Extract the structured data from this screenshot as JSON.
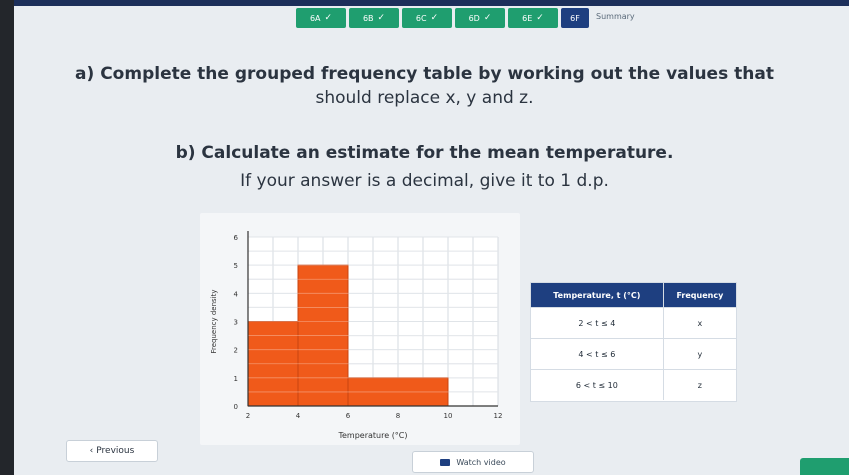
{
  "header": {
    "progress_tabs": [
      {
        "label": "6A",
        "completed": true
      },
      {
        "label": "6B",
        "completed": true
      },
      {
        "label": "6C",
        "completed": true
      },
      {
        "label": "6D",
        "completed": true
      },
      {
        "label": "6E",
        "completed": true
      },
      {
        "label": "6F",
        "completed": false
      }
    ],
    "summary_label": "Summary"
  },
  "question": {
    "part_a_line1": "a) Complete the grouped frequency table by working out the values that",
    "part_a_line2": "should replace x, y and z.",
    "part_b_line1": "b) Calculate an estimate for the mean temperature.",
    "part_b_line2": "If your answer is a decimal, give it to 1 d.p."
  },
  "chart_data": {
    "type": "bar",
    "xlabel": "Temperature (°C)",
    "ylabel": "Frequency density",
    "x_ticks": [
      2,
      4,
      6,
      8,
      10,
      12
    ],
    "y_ticks": [
      0,
      1,
      2,
      3,
      4,
      5,
      6
    ],
    "xlim": [
      2,
      12
    ],
    "ylim": [
      0,
      6
    ],
    "bars": [
      {
        "x0": 2,
        "x1": 4,
        "value": 3
      },
      {
        "x0": 4,
        "x1": 6,
        "value": 5
      },
      {
        "x0": 6,
        "x1": 10,
        "value": 1
      }
    ],
    "bar_color": "#f05a1a",
    "grid": true
  },
  "table": {
    "headers": [
      "Temperature, t (°C)",
      "Frequency"
    ],
    "rows": [
      {
        "range": "2 < t ≤ 4",
        "freq": "x"
      },
      {
        "range": "4 < t ≤ 6",
        "freq": "y"
      },
      {
        "range": "6 < t ≤ 10",
        "freq": "z"
      }
    ]
  },
  "footer": {
    "previous_label": "Previous",
    "watch_video_label": "Watch video"
  }
}
